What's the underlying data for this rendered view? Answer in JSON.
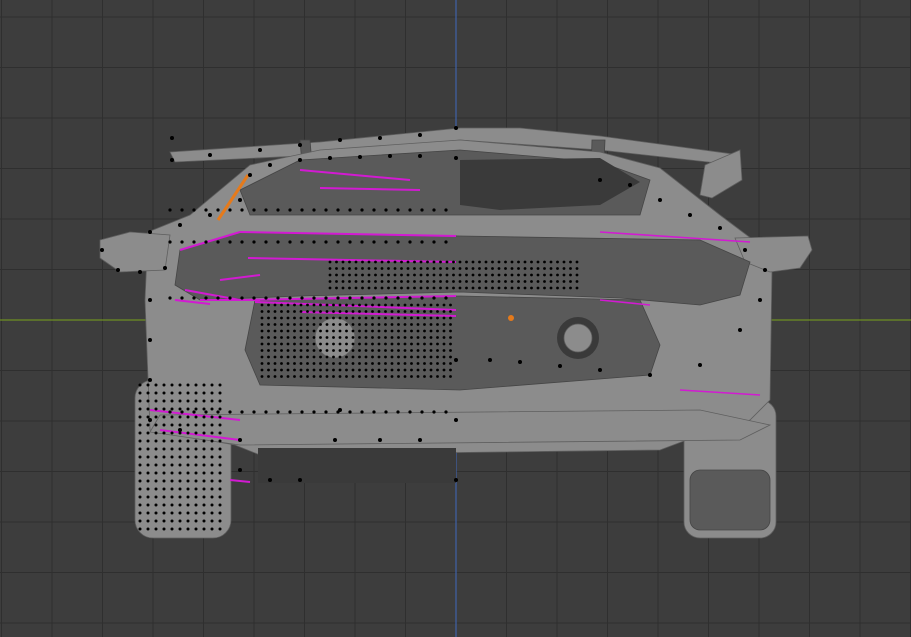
{
  "app": "blender",
  "view": {
    "mode": "edit-mode",
    "projection": "orthographic",
    "orientation": "front"
  },
  "colors": {
    "background": "#3d3d3d",
    "grid_minor": "#363636",
    "grid_major": "#2f2f2f",
    "axis_z": "#3f62a8",
    "axis_x": "#6e8e22",
    "mesh_fill": "#8c8c8c",
    "mesh_dark": "#5a5a5a",
    "mesh_shadow": "#3a3a3a",
    "vertex": "#000000",
    "seam": "#d21ad2",
    "selected": "#e57a1b"
  },
  "scene": {
    "object": "sports-car-rear",
    "left_half": "edit-mesh-wireframe",
    "right_half": "solid-shaded"
  }
}
